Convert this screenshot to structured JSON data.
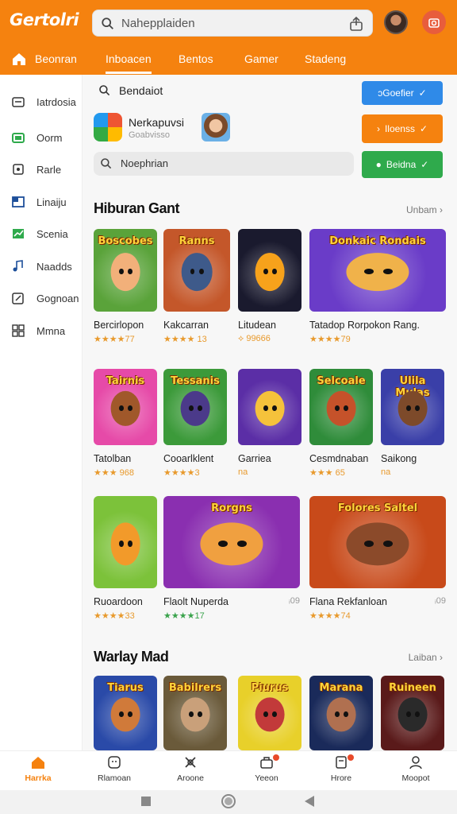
{
  "app": {
    "brand": "Gertolri"
  },
  "search": {
    "placeholder": "Nahepplaiden"
  },
  "nav": {
    "tabs": [
      "Beonran",
      "Inboacen",
      "Bentos",
      "Gamer",
      "Stadeng"
    ],
    "active_index": 1
  },
  "sidebar": {
    "items": [
      "Iatrdosia",
      "Oorm",
      "Rarle",
      "Linaiju",
      "Scenia",
      "Naadds",
      "Gognoan",
      "Mmna"
    ]
  },
  "main": {
    "quick_search_label": "Bendaiot",
    "buttons": {
      "blue": "ɔGoefier",
      "orange": "Iloenss",
      "green": "Beidna"
    },
    "app": {
      "name": "Nerkapuvsi",
      "sub": "Goabvisso"
    },
    "search2_placeholder": "Noephrian"
  },
  "section1": {
    "title": "Hiburan Gant",
    "more": "Unbam ›",
    "row1": [
      {
        "name": "Bercirlopon",
        "rating": "★★★★77",
        "thumb_title": "Boscobes",
        "bg": "#5aa33a",
        "face": "#f2b07a"
      },
      {
        "name": "Kakcarran",
        "rating": "★★★★ 13",
        "thumb_title": "Ranns",
        "bg": "#c4572a",
        "face": "#3e5a8a"
      },
      {
        "name": "Litudean",
        "rating": "⟡ 99666",
        "thumb_title": "",
        "bg": "#1a1a2e",
        "face": "#f7a21b"
      },
      {
        "name": "Tatadop Rorpokon Rang.",
        "rating": "★★★★79",
        "thumb_title": "Donkaic Rondais",
        "bg": "#6a3cc8",
        "face": "#f0b24a"
      }
    ],
    "row2": [
      {
        "name": "Tatolban",
        "rating": "★★★ 968",
        "thumb_title": "Tairnis",
        "bg": "#e64aa8",
        "face": "#a0582a"
      },
      {
        "name": "Cooarlklent",
        "rating": "★★★★3",
        "thumb_title": "Tessanis",
        "bg": "#3c9a3a",
        "face": "#4b3a8a"
      },
      {
        "name": "Garriea",
        "rating": "na",
        "thumb_title": "",
        "bg": "#5b2ea6",
        "face": "#f5c23b"
      },
      {
        "name": "Cesmdnaban",
        "rating": "★★★ 65",
        "thumb_title": "Selcoale",
        "bg": "#2f8c3a",
        "face": "#c5522a"
      },
      {
        "name": "Saikong",
        "rating": "na",
        "thumb_title": "Ulila Mulas",
        "bg": "#3a3fa8",
        "face": "#7d4a2a"
      }
    ],
    "row3": [
      {
        "name": "Ruoardoon",
        "rating": "★★★★33",
        "thumb_title": "",
        "bg": "#7cc23a",
        "face": "#f29a2a"
      },
      {
        "name": "Flaolt Nuperda",
        "rating": "★★★★17",
        "thumb_title": "Rorgns",
        "bg": "#8a2fb0",
        "face": "#f0a040",
        "side": "ᵢ09",
        "green": true
      },
      {
        "name": "Flana Rekfanloan",
        "rating": "★★★★74",
        "thumb_title": "Folores Saltel",
        "bg": "#c84a1a",
        "face": "#8b4a2a",
        "side": "ᵢ09"
      }
    ]
  },
  "section2": {
    "title": "Warlay Mad",
    "more": "Laiban ›",
    "row": [
      {
        "thumb_title": "Tiarus",
        "bg": "#2a4aa8",
        "face": "#d07a3a"
      },
      {
        "thumb_title": "Babilrers",
        "bg": "#6a5a3a",
        "face": "#c9a07a"
      },
      {
        "thumb_title": "Piurus",
        "bg": "#e8d02a",
        "face": "#c23a3a"
      },
      {
        "thumb_title": "Marana",
        "bg": "#1a2a5a",
        "face": "#b07050"
      },
      {
        "thumb_title": "Ruineen",
        "bg": "#5a1a1a",
        "face": "#2a2a2a"
      }
    ]
  },
  "bottom_nav": [
    "Harrka",
    "Rlamoan",
    "Aroone",
    "Yeeon",
    "Hrore",
    "Moopot"
  ],
  "colors": {
    "accent": "#f5820f",
    "blue": "#2f8ae8",
    "green": "#2faa4c"
  }
}
